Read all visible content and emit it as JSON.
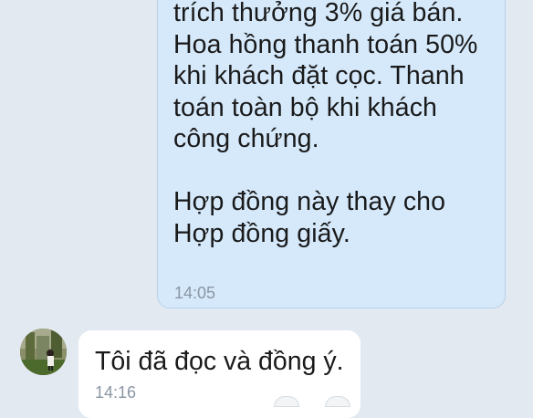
{
  "chat": {
    "outgoing": {
      "text": "trích thưởng 3% giá bán.\nHoa hồng thanh toán 50%\nkhi khách đặt cọc. Thanh\ntoán toàn bộ khi khách\ncông chứng.\n\nHợp đồng này thay cho\nHợp đồng giấy.",
      "time": "14:05"
    },
    "incoming": {
      "text": "Tôi đã đọc và đồng ý.",
      "time": "14:16"
    }
  },
  "colors": {
    "background": "#e2e9f1",
    "outgoing_bubble": "#d5e9fb",
    "incoming_bubble": "#ffffff",
    "timestamp": "#8b96a3"
  },
  "icons": {
    "avatar": "sender-avatar-photo"
  }
}
